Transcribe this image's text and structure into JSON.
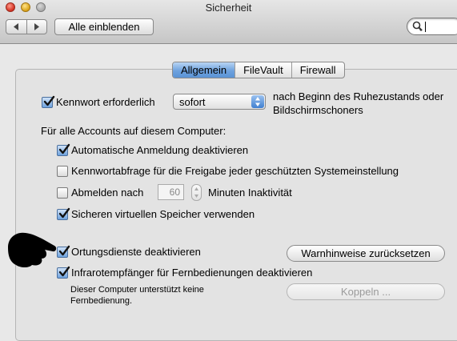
{
  "window": {
    "title": "Sicherheit"
  },
  "toolbar": {
    "show_all_label": "Alle einblenden",
    "search_value": ""
  },
  "tabs": [
    {
      "label": "Allgemein",
      "active": true
    },
    {
      "label": "FileVault",
      "active": false
    },
    {
      "label": "Firewall",
      "active": false
    }
  ],
  "general": {
    "password_required": {
      "label": "Kennwort erforderlich",
      "checked": true
    },
    "password_delay": {
      "value": "sofort"
    },
    "after_text_line1": "nach Beginn des Ruhezustands oder",
    "after_text_line2": "Bildschirmschoners",
    "all_accounts_heading": "Für alle Accounts auf diesem Computer:",
    "options": [
      {
        "label": "Automatische Anmeldung deaktivieren",
        "checked": true
      },
      {
        "label": "Kennwortabfrage für die Freigabe jeder geschützten Systemeinstellung",
        "checked": false
      },
      {
        "label": "Abmelden nach",
        "checked": false
      },
      {
        "label": "Sicheren virtuellen Speicher verwenden",
        "checked": true
      },
      {
        "label": "Ortungsdienste deaktivieren",
        "checked": true
      },
      {
        "label": "Infrarotempfänger für Fernbedienungen deaktivieren",
        "checked": true
      }
    ],
    "logout_minutes": "60",
    "logout_suffix": "Minuten Inaktivität",
    "reset_warnings_label": "Warnhinweise zurücksetzen",
    "remote_note_line1": "Dieser Computer unterstützt keine",
    "remote_note_line2": "Fernbedienung.",
    "pair_label": "Koppeln ..."
  },
  "colors": {
    "accent": "#5a93d6",
    "panel": "#e3e3e3"
  }
}
